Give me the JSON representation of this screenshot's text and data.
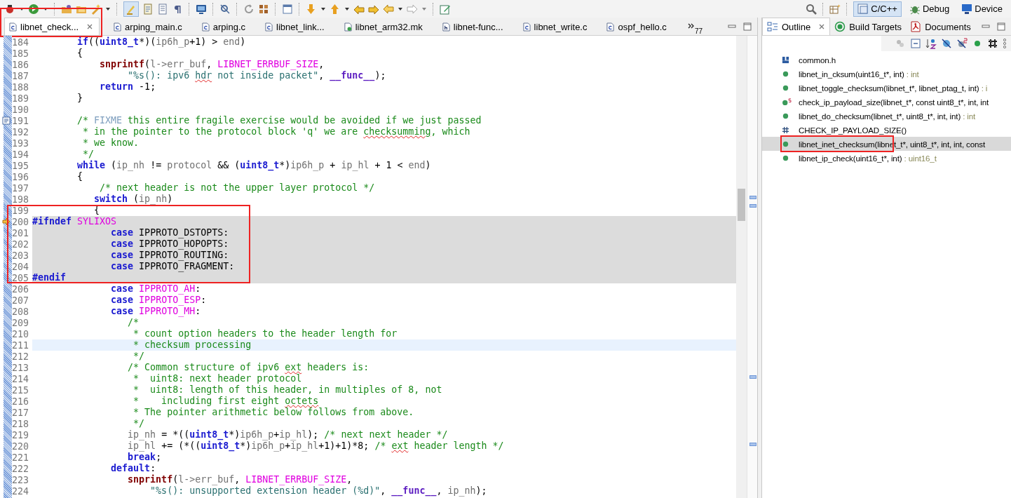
{
  "perspectives": [
    {
      "label": "C/C++",
      "kind": "c",
      "selected": true
    },
    {
      "label": "Debug",
      "kind": "debug",
      "selected": false
    },
    {
      "label": "Device",
      "kind": "device",
      "selected": false
    }
  ],
  "editor_tabs": [
    {
      "label": "libnet_check...",
      "kind": "c",
      "selected": true,
      "boxed": true
    },
    {
      "label": "arping_main.c",
      "kind": "c",
      "selected": false,
      "boxed": false
    },
    {
      "label": "arping.c",
      "kind": "c",
      "selected": false,
      "boxed": false
    },
    {
      "label": "libnet_link...",
      "kind": "c",
      "selected": false,
      "boxed": false
    },
    {
      "label": "libnet_arm32.mk",
      "kind": "mk",
      "selected": false,
      "boxed": false
    },
    {
      "label": "libnet-func...",
      "kind": "h",
      "selected": false,
      "boxed": false
    },
    {
      "label": "libnet_write.c",
      "kind": "c",
      "selected": false,
      "boxed": false
    },
    {
      "label": "ospf_hello.c",
      "kind": "c",
      "selected": false,
      "boxed": false
    }
  ],
  "hidden_tabs": {
    "count": "77"
  },
  "code": [
    {
      "number": "184",
      "tokens": [
        {
          "text": "        if",
          "kind": "kw"
        },
        {
          "text": "((",
          "kind": "plain"
        },
        {
          "text": "uint8_t",
          "kind": "kw"
        },
        {
          "text": "*)(",
          "kind": "plain"
        },
        {
          "text": "ip6h_p",
          "kind": "var"
        },
        {
          "text": "+1) > ",
          "kind": "plain"
        },
        {
          "text": "end",
          "kind": "var"
        },
        {
          "text": ")",
          "kind": "plain"
        }
      ]
    },
    {
      "number": "185",
      "tokens": [
        {
          "text": "        {",
          "kind": "plain"
        }
      ]
    },
    {
      "number": "186",
      "tokens": [
        {
          "text": "            snprintf",
          "kind": "fn"
        },
        {
          "text": "(",
          "kind": "plain"
        },
        {
          "text": "l->err_buf",
          "kind": "var"
        },
        {
          "text": ", ",
          "kind": "plain"
        },
        {
          "text": "LIBNET_ERRBUF_SIZE",
          "kind": "macro"
        },
        {
          "text": ",",
          "kind": "plain"
        }
      ]
    },
    {
      "number": "187",
      "tokens": [
        {
          "text": "                 \"%s(): ipv6 ",
          "kind": "str"
        },
        {
          "text": "hdr",
          "kind": "str",
          "squiggle": true
        },
        {
          "text": " not inside packet\"",
          "kind": "str"
        },
        {
          "text": ", ",
          "kind": "plain"
        },
        {
          "text": "__func__",
          "kind": "builtin"
        },
        {
          "text": ");",
          "kind": "plain"
        }
      ]
    },
    {
      "number": "188",
      "tokens": [
        {
          "text": "            return",
          "kind": "kw"
        },
        {
          "text": " -1;",
          "kind": "plain"
        }
      ]
    },
    {
      "number": "189",
      "tokens": [
        {
          "text": "        }",
          "kind": "plain"
        }
      ]
    },
    {
      "number": "190"
    },
    {
      "number": "191",
      "task_marker": true,
      "tokens": [
        {
          "text": "        /* ",
          "kind": "comment"
        },
        {
          "text": "FIXME",
          "kind": "task"
        },
        {
          "text": " this entire fragile exercise would be avoided if we just passed",
          "kind": "comment"
        }
      ]
    },
    {
      "number": "192",
      "tokens": [
        {
          "text": "         * in the pointer to the protocol block 'q' we are ",
          "kind": "comment"
        },
        {
          "text": "checksumming",
          "kind": "comment",
          "squiggle": true
        },
        {
          "text": ", which",
          "kind": "comment"
        }
      ]
    },
    {
      "number": "193",
      "tokens": [
        {
          "text": "         * we know.",
          "kind": "comment"
        }
      ]
    },
    {
      "number": "194",
      "tokens": [
        {
          "text": "         */",
          "kind": "comment"
        }
      ]
    },
    {
      "number": "195",
      "tokens": [
        {
          "text": "        while",
          "kind": "kw"
        },
        {
          "text": " (",
          "kind": "plain"
        },
        {
          "text": "ip_nh",
          "kind": "var"
        },
        {
          "text": " != ",
          "kind": "plain"
        },
        {
          "text": "protocol",
          "kind": "var"
        },
        {
          "text": " && (",
          "kind": "plain"
        },
        {
          "text": "uint8_t",
          "kind": "kw"
        },
        {
          "text": "*)",
          "kind": "plain"
        },
        {
          "text": "ip6h_p",
          "kind": "var"
        },
        {
          "text": " + ",
          "kind": "plain"
        },
        {
          "text": "ip_hl",
          "kind": "var"
        },
        {
          "text": " + 1 < ",
          "kind": "plain"
        },
        {
          "text": "end",
          "kind": "var"
        },
        {
          "text": ")",
          "kind": "plain"
        }
      ]
    },
    {
      "number": "196",
      "tokens": [
        {
          "text": "        {",
          "kind": "plain"
        }
      ]
    },
    {
      "number": "197",
      "tokens": [
        {
          "text": "            /* next header is not the upper layer protocol */",
          "kind": "comment"
        }
      ]
    },
    {
      "number": "198",
      "tokens": [
        {
          "text": "           switch",
          "kind": "kw"
        },
        {
          "text": " (",
          "kind": "plain"
        },
        {
          "text": "ip_nh",
          "kind": "var"
        },
        {
          "text": ")",
          "kind": "plain"
        }
      ]
    },
    {
      "number": "199",
      "boxed": true,
      "tokens": [
        {
          "text": "           {",
          "kind": "plain"
        }
      ]
    },
    {
      "number": "200",
      "boxed": true,
      "inactive": true,
      "arrow_marker": true,
      "tokens": [
        {
          "text": "#ifndef",
          "kind": "pre"
        },
        {
          "text": " SYLIXOS",
          "kind": "macro"
        }
      ]
    },
    {
      "number": "201",
      "boxed": true,
      "inactive": true,
      "tokens": [
        {
          "text": "              case",
          "kind": "kw"
        },
        {
          "text": " IPPROTO_DSTOPTS:",
          "kind": "plain"
        }
      ]
    },
    {
      "number": "202",
      "boxed": true,
      "inactive": true,
      "tokens": [
        {
          "text": "              case",
          "kind": "kw"
        },
        {
          "text": " IPPROTO_HOPOPTS:",
          "kind": "plain"
        }
      ]
    },
    {
      "number": "203",
      "boxed": true,
      "inactive": true,
      "tokens": [
        {
          "text": "              case",
          "kind": "kw"
        },
        {
          "text": " IPPROTO_ROUTING:",
          "kind": "plain"
        }
      ]
    },
    {
      "number": "204",
      "boxed": true,
      "inactive": true,
      "tokens": [
        {
          "text": "              case",
          "kind": "kw"
        },
        {
          "text": " IPPROTO_FRAGMENT:",
          "kind": "plain"
        }
      ]
    },
    {
      "number": "205",
      "boxed": true,
      "inactive": true,
      "tokens": [
        {
          "text": "#endif",
          "kind": "pre"
        }
      ]
    },
    {
      "number": "206",
      "tokens": [
        {
          "text": "              case",
          "kind": "kw"
        },
        {
          "text": " IPPROTO_AH",
          "kind": "macro"
        },
        {
          "text": ":",
          "kind": "plain"
        }
      ]
    },
    {
      "number": "207",
      "tokens": [
        {
          "text": "              case",
          "kind": "kw"
        },
        {
          "text": " IPPROTO_ESP",
          "kind": "macro"
        },
        {
          "text": ":",
          "kind": "plain"
        }
      ]
    },
    {
      "number": "208",
      "tokens": [
        {
          "text": "              case",
          "kind": "kw"
        },
        {
          "text": " IPPROTO_MH",
          "kind": "macro"
        },
        {
          "text": ":",
          "kind": "plain"
        }
      ]
    },
    {
      "number": "209",
      "tokens": [
        {
          "text": "                 /*",
          "kind": "comment"
        }
      ]
    },
    {
      "number": "210",
      "tokens": [
        {
          "text": "                  * count option headers to the header length for",
          "kind": "comment"
        }
      ]
    },
    {
      "number": "211",
      "current": true,
      "tokens": [
        {
          "text": "                  * checksum processing",
          "kind": "comment"
        }
      ]
    },
    {
      "number": "212",
      "tokens": [
        {
          "text": "                  */",
          "kind": "comment"
        }
      ]
    },
    {
      "number": "213",
      "tokens": [
        {
          "text": "                 /* Common structure of ipv6 ",
          "kind": "comment"
        },
        {
          "text": "ext",
          "kind": "comment",
          "squiggle": true
        },
        {
          "text": " headers is:",
          "kind": "comment"
        }
      ]
    },
    {
      "number": "214",
      "tokens": [
        {
          "text": "                  *  uint8: next header protocol",
          "kind": "comment"
        }
      ]
    },
    {
      "number": "215",
      "tokens": [
        {
          "text": "                  *  uint8: length of this header, in multiples of 8, not",
          "kind": "comment"
        }
      ]
    },
    {
      "number": "216",
      "tokens": [
        {
          "text": "                  *    including first eight ",
          "kind": "comment"
        },
        {
          "text": "octets",
          "kind": "comment",
          "squiggle": true
        }
      ]
    },
    {
      "number": "217",
      "tokens": [
        {
          "text": "                  * The pointer arithmetic below follows from above.",
          "kind": "comment"
        }
      ]
    },
    {
      "number": "218",
      "tokens": [
        {
          "text": "                  */",
          "kind": "comment"
        }
      ]
    },
    {
      "number": "219",
      "tokens": [
        {
          "text": "                 ip_nh",
          "kind": "var"
        },
        {
          "text": " = *((",
          "kind": "plain"
        },
        {
          "text": "uint8_t",
          "kind": "kw"
        },
        {
          "text": "*)",
          "kind": "plain"
        },
        {
          "text": "ip6h_p",
          "kind": "var"
        },
        {
          "text": "+",
          "kind": "plain"
        },
        {
          "text": "ip_hl",
          "kind": "var"
        },
        {
          "text": "); ",
          "kind": "plain"
        },
        {
          "text": "/* next next header */",
          "kind": "comment"
        }
      ]
    },
    {
      "number": "220",
      "tokens": [
        {
          "text": "                 ip_hl",
          "kind": "var"
        },
        {
          "text": " += (*((",
          "kind": "plain"
        },
        {
          "text": "uint8_t",
          "kind": "kw"
        },
        {
          "text": "*)",
          "kind": "plain"
        },
        {
          "text": "ip6h_p",
          "kind": "var"
        },
        {
          "text": "+",
          "kind": "plain"
        },
        {
          "text": "ip_hl",
          "kind": "var"
        },
        {
          "text": "+1)+1)*8; ",
          "kind": "plain"
        },
        {
          "text": "/* ",
          "kind": "comment"
        },
        {
          "text": "ext",
          "kind": "comment",
          "squiggle": true
        },
        {
          "text": " header length */",
          "kind": "comment"
        }
      ]
    },
    {
      "number": "221",
      "tokens": [
        {
          "text": "                 break",
          "kind": "kw"
        },
        {
          "text": ";",
          "kind": "plain"
        }
      ]
    },
    {
      "number": "222",
      "tokens": [
        {
          "text": "              default",
          "kind": "kw"
        },
        {
          "text": ":",
          "kind": "plain"
        }
      ]
    },
    {
      "number": "223",
      "tokens": [
        {
          "text": "                 snprintf",
          "kind": "fn"
        },
        {
          "text": "(",
          "kind": "plain"
        },
        {
          "text": "l->err_buf",
          "kind": "var"
        },
        {
          "text": ", ",
          "kind": "plain"
        },
        {
          "text": "LIBNET_ERRBUF_SIZE",
          "kind": "macro"
        },
        {
          "text": ",",
          "kind": "plain"
        }
      ]
    },
    {
      "number": "224",
      "tokens": [
        {
          "text": "                     \"%s(): unsupported extension header (%d)\"",
          "kind": "str"
        },
        {
          "text": ", ",
          "kind": "plain"
        },
        {
          "text": "__func__",
          "kind": "builtin"
        },
        {
          "text": ", ",
          "kind": "plain"
        },
        {
          "text": "ip_nh",
          "kind": "var"
        },
        {
          "text": ");",
          "kind": "plain"
        }
      ]
    }
  ],
  "side_tabs": [
    {
      "label": "Outline",
      "kind": "outline",
      "selected": true
    },
    {
      "label": "Build Targets",
      "kind": "targets",
      "selected": false
    },
    {
      "label": "Documents",
      "kind": "pdf",
      "selected": false
    }
  ],
  "outline": [
    {
      "name": "common.h",
      "kind": "include",
      "selected": false,
      "boxed": false
    },
    {
      "name": "libnet_in_cksum(uint16_t*, int)",
      "type": " : int",
      "kind": "function",
      "selected": false,
      "boxed": false
    },
    {
      "name": "libnet_toggle_checksum(libnet_t*, libnet_ptag_t, int)",
      "type": " : i",
      "kind": "function",
      "selected": false,
      "boxed": false
    },
    {
      "name": "check_ip_payload_size(libnet_t*, const uint8_t*, int, int",
      "kind": "static",
      "selected": false,
      "boxed": false
    },
    {
      "name": "libnet_do_checksum(libnet_t*, uint8_t*, int, int)",
      "type": " : int",
      "kind": "function",
      "selected": false,
      "boxed": false
    },
    {
      "name": "CHECK_IP_PAYLOAD_SIZE()",
      "kind": "macro",
      "selected": false,
      "boxed": false
    },
    {
      "name": "libnet_inet_checksum(libnet_t*, uint8_t*, int, int, const",
      "kind": "function",
      "selected": true,
      "boxed": true
    },
    {
      "name": "libnet_ip_check(uint16_t*, int)",
      "type": " : uint16_t",
      "kind": "function",
      "selected": false,
      "boxed": false
    }
  ]
}
